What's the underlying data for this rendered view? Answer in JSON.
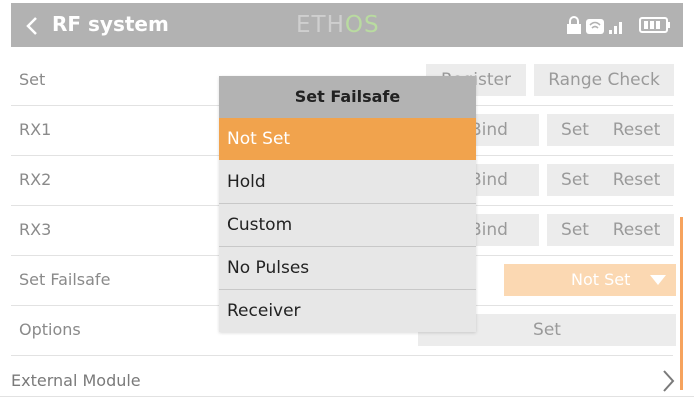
{
  "header": {
    "title": "RF system",
    "logo_left": "ETH",
    "logo_right": "OS"
  },
  "rows": {
    "set": {
      "label": "Set",
      "register": "Register",
      "range_check": "Range Check"
    },
    "rx1": {
      "label": "RX1",
      "bind": "Bind",
      "set": "Set",
      "reset": "Reset"
    },
    "rx2": {
      "label": "RX2",
      "bind": "Bind",
      "set": "Set",
      "reset": "Reset"
    },
    "rx3": {
      "label": "RX3",
      "bind": "Bind",
      "set": "Set",
      "reset": "Reset"
    },
    "failsafe": {
      "label": "Set Failsafe",
      "value": "Not Set"
    },
    "options": {
      "label": "Options",
      "set": "Set"
    },
    "external": {
      "label": "External Module"
    }
  },
  "popup": {
    "title": "Set Failsafe",
    "options": [
      "Not Set",
      "Hold",
      "Custom",
      "No Pulses",
      "Receiver"
    ],
    "selected": "Not Set"
  },
  "colors": {
    "accent": "#f1a34d",
    "dropdown_bg": "#fbd8b2",
    "header_bg": "#b2b2b2"
  },
  "icons": [
    "back-chevron-icon",
    "lock-icon",
    "rf-module-icon",
    "signal-bars-icon",
    "battery-icon",
    "dropdown-triangle-icon",
    "chevron-right-icon"
  ]
}
